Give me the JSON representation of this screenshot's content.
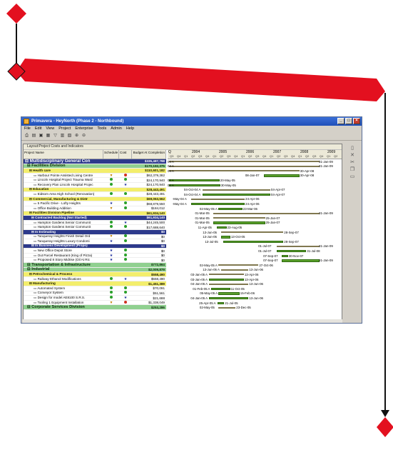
{
  "window": {
    "title": "Primavera - HeyNorth (Phase 2 - Northbound)",
    "menu": [
      "File",
      "Edit",
      "View",
      "Project",
      "Enterprise",
      "Tools",
      "Admin",
      "Help"
    ]
  },
  "panel": {
    "title": "Layout:Project Costs and Indicators"
  },
  "columns": {
    "name": "Project Name",
    "schedule": "Schedule",
    "cost": "Cost",
    "budget": "Budget At Completion"
  },
  "timeline": {
    "years": [
      "2004",
      "2005",
      "2006",
      "2007",
      "2008",
      "2009"
    ],
    "quarters": [
      "Q3",
      "Q4",
      "Q1",
      "Q2",
      "Q3",
      "Q4",
      "Q1",
      "Q2",
      "Q3",
      "Q4",
      "Q1",
      "Q2",
      "Q3",
      "Q4",
      "Q1",
      "Q2",
      "Q3",
      "Q4",
      "Q1",
      "Q2",
      "Q3",
      "Q4",
      "Q1",
      "Q2"
    ],
    "leading": "Q"
  },
  "rows": [
    {
      "name": "Multidisciplinary General Con",
      "level": 0,
      "budget": "$335,487,798",
      "schedule": "",
      "cost": "",
      "start_lbl": "04 A",
      "end_lbl": "31-Jan-09"
    },
    {
      "name": "Facilities Division",
      "level": 1,
      "budget": "$170,192,375",
      "schedule": "",
      "cost": "",
      "start_lbl": "04 A",
      "end_lbl": "31-Jan-09"
    },
    {
      "name": "Health care",
      "level": 2,
      "budget": "$110,601,182",
      "schedule": "",
      "cost": "",
      "start_lbl": "04 A",
      "end_lbl": "30-Apr-08"
    },
    {
      "name": "Harbour Pointe Assisted Living Centre",
      "level": 4,
      "budget": "$62,379,382",
      "schedule": "warn",
      "cost": "red",
      "start_lbl": "08-Jan-07",
      "end_lbl": "30-Apr-08"
    },
    {
      "name": "Lincoln Hospital Project Trauma Ward",
      "level": 4,
      "budget": "$24,170,940",
      "schedule": "green",
      "cost": "green",
      "start_lbl": "04 A",
      "end_lbl": "20-May-05"
    },
    {
      "name": "Recovery Plan Lincoln Hospital Projec",
      "level": 4,
      "budget": "$24,170,940",
      "schedule": "green",
      "cost": "star",
      "start_lbl": "04 A",
      "end_lbl": "30-May-05"
    },
    {
      "name": "Education",
      "level": 2,
      "budget": "$28,443,491",
      "schedule": "",
      "cost": "",
      "start_lbl": "04-Oct-04 A",
      "end_lbl": "04-Apr-07"
    },
    {
      "name": "Eidsom Area High School (Renovation)",
      "level": 4,
      "budget": "$28,443,491",
      "schedule": "green",
      "cost": "green",
      "start_lbl": "04-Oct-04 A",
      "end_lbl": "04-Apr-07"
    },
    {
      "name": "Commercial, Manufacturing & Distr",
      "level": 2,
      "budget": "$69,063,562",
      "schedule": "",
      "cost": "",
      "start_lbl": "-May-04 A",
      "end_lbl": "24-Apr-06"
    },
    {
      "name": "5 Pacific Drive - Lofty Heights",
      "level": 4,
      "budget": "$68,879,550",
      "schedule": "star",
      "cost": "green",
      "start_lbl": "-May-04 A",
      "end_lbl": "24-Apr-06"
    },
    {
      "name": "Office Building Addition",
      "level": 4,
      "budget": "$184,012",
      "schedule": "warn",
      "cost": "green",
      "start_lbl": "02-May-05 A",
      "end_lbl": "23-Mar-06"
    },
    {
      "name": "Facilities Division Pipeline",
      "level": 2,
      "budget": "$61,934,140",
      "schedule": "",
      "cost": "",
      "start_lbl": "01-Mar-05",
      "end_lbl": "31-Jan-09"
    },
    {
      "name": "Contracted Backlog (Not Started)",
      "level": 3,
      "budget": "$61,934,140",
      "schedule": "",
      "cost": "",
      "start_lbl": "01-Mar-05",
      "end_lbl": "25-Jan-07"
    },
    {
      "name": "Hampton Gardens Senior Communit",
      "level": 4,
      "budget": "$44,245,500",
      "schedule": "green",
      "cost": "star",
      "start_lbl": "01-Mar-05",
      "end_lbl": "25-Jan-07"
    },
    {
      "name": "Hampton Gardens Senior Communit",
      "level": 4,
      "budget": "$17,688,640",
      "schedule": "green",
      "cost": "green",
      "start_lbl": "11-Apr-05",
      "end_lbl": "23-Aug-05"
    },
    {
      "name": "In Estimating",
      "level": 3,
      "budget": "$0",
      "schedule": "",
      "cost": "",
      "start_lbl": "13-Jun-05",
      "end_lbl": "28-Sep-07"
    },
    {
      "name": "Tanqueray Heights Finish Detail Ord",
      "level": 4,
      "budget": "$0",
      "schedule": "warn",
      "cost": "green",
      "start_lbl": "13-Jun-05",
      "end_lbl": "13-Oct-05"
    },
    {
      "name": "Tanqueray Heights Luxury Condomi",
      "level": 4,
      "budget": "$0",
      "schedule": "star",
      "cost": "green",
      "start_lbl": "13-Jul-05",
      "end_lbl": "28-Sep-07"
    },
    {
      "name": "In Business Development (Propo)",
      "level": 3,
      "budget": "$0",
      "schedule": "",
      "cost": "",
      "start_lbl": "01-Jul-07",
      "end_lbl": "31-Jan-09"
    },
    {
      "name": "New Office Depot Store",
      "level": 4,
      "budget": "$0",
      "schedule": "star",
      "cost": "green",
      "start_lbl": "01-Jul-07",
      "end_lbl": "31-Jul-08"
    },
    {
      "name": "Out Parcel Restaurant (King of Pizza)",
      "level": 4,
      "budget": "$0",
      "schedule": "star",
      "cost": "green",
      "start_lbl": "07-Sep-07",
      "end_lbl": "30-Nov-07"
    },
    {
      "name": "Proposed 8 Story Midrise (Oil At Ric",
      "level": 4,
      "budget": "$0",
      "schedule": "star",
      "cost": "green",
      "start_lbl": "07-Sep-07",
      "end_lbl": "31-Jan-09"
    },
    {
      "name": "Transportation & Infrastructure",
      "level": 1,
      "budget": "$772,864",
      "schedule": "",
      "cost": "",
      "start_lbl": "02-May-05 A",
      "end_lbl": "27-Oct-06"
    },
    {
      "name": "Industrial",
      "level": 1,
      "budget": "$2,009,879",
      "schedule": "",
      "cost": "",
      "start_lbl": "13-Jun-05 A",
      "end_lbl": "13-Jun-06"
    },
    {
      "name": "Petrochemical & Process",
      "level": 2,
      "budget": "$558,490",
      "schedule": "",
      "cost": "",
      "start_lbl": "03-Jan-05 A",
      "end_lbl": "13-Apr-06"
    },
    {
      "name": "Railway Ethanol Modifications",
      "level": 4,
      "budget": "$558,490",
      "schedule": "green",
      "cost": "star",
      "start_lbl": "03-Jan-05 A",
      "end_lbl": "13-Apr-06"
    },
    {
      "name": "Manufacturing",
      "level": 2,
      "budget": "$1,451,389",
      "schedule": "",
      "cost": "",
      "start_lbl": "04-Jan-05 A",
      "end_lbl": "13-Jun-06"
    },
    {
      "name": "Automated System",
      "level": 4,
      "budget": "$70,091",
      "schedule": "green",
      "cost": "green",
      "start_lbl": "01-Feb-05 A",
      "end_lbl": "11-Oct-05"
    },
    {
      "name": "Conveyor System",
      "level": 4,
      "budget": "$51,561",
      "schedule": "green",
      "cost": "green",
      "start_lbl": "05-May-05 A",
      "end_lbl": "15-Feb-06"
    },
    {
      "name": "Design for model AE8100 S.R.S.",
      "level": 4,
      "budget": "$21,688",
      "schedule": "green",
      "cost": "star",
      "start_lbl": "04-Jan-05 A",
      "end_lbl": "13-Jun-06"
    },
    {
      "name": "Tooling 1 Equipment Installation",
      "level": 4,
      "budget": "$1,338,049",
      "schedule": "warn",
      "cost": "red",
      "start_lbl": "25-Apr-05 A",
      "end_lbl": "21-Jul-05"
    },
    {
      "name": "Corporate Services Division",
      "level": 1,
      "budget": "$253,286",
      "schedule": "",
      "cost": "",
      "start_lbl": "02-May-05",
      "end_lbl": "23-Dec-05"
    }
  ]
}
